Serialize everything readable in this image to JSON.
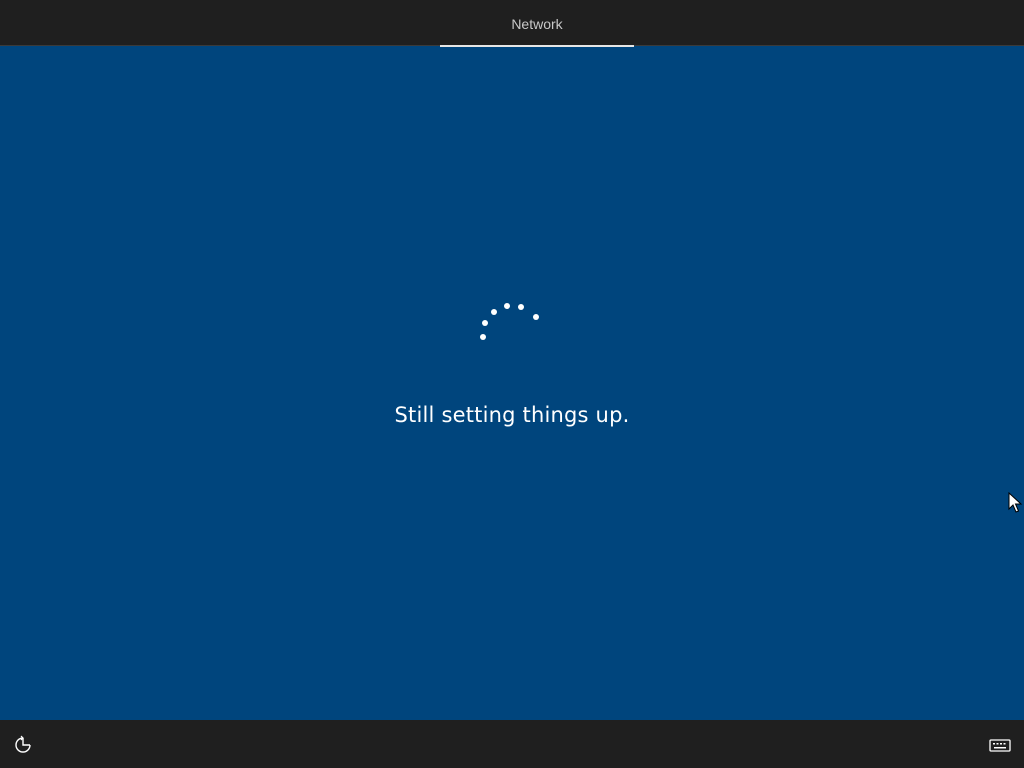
{
  "header": {
    "tabs": [
      {
        "label": "Network",
        "active": true
      }
    ]
  },
  "main": {
    "spinner_icon": "loading-dots-icon",
    "status_message": "Still setting things up."
  },
  "footer": {
    "left_icon": "ease-of-access-icon",
    "right_icon": "keyboard-icon"
  },
  "colors": {
    "background": "#00457d",
    "bar": "#1f1f1f",
    "text": "#ffffff",
    "tab_text": "#c8c8c8"
  }
}
